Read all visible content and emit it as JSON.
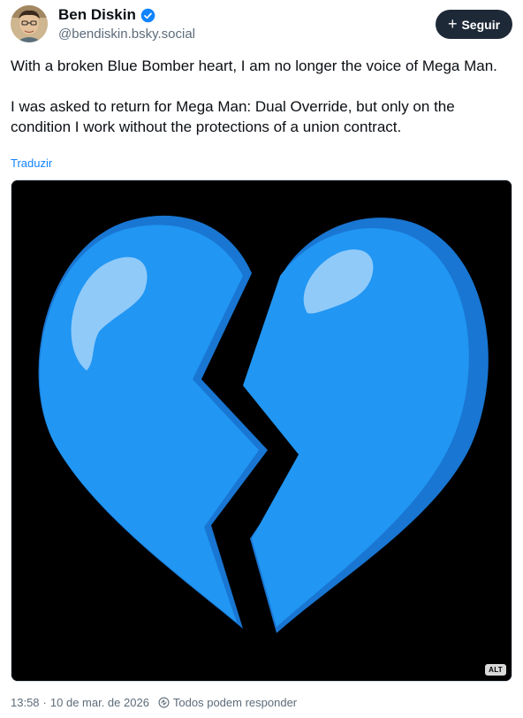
{
  "author": {
    "display_name": "Ben Diskin",
    "handle": "@bendiskin.bsky.social",
    "verified": true
  },
  "follow_button": {
    "icon": "plus-icon",
    "label": "Seguir"
  },
  "post": {
    "paragraphs": [
      "With a broken Blue Bomber heart, I am no longer the voice of Mega Man.",
      "I was asked to return for Mega Man: Dual Override, but only on the condition I work without the protections of a union contract."
    ],
    "translate_label": "Traduzir",
    "media": {
      "icon": "broken-heart-emoji",
      "alt_badge": "ALT"
    }
  },
  "meta": {
    "timestamp": "13:58",
    "separator": "·",
    "date": "10 de mar. de 2026",
    "reply_icon": "reply-settings-icon",
    "reply_settings": "Todos podem responder"
  },
  "colors": {
    "follow_button_bg": "#1e2937",
    "link": "#1083fe",
    "verified": "#1083fe",
    "heart_main": "#2196f3",
    "heart_shade": "#1976d2",
    "heart_highlight": "#90caf9",
    "secondary_text": "#5d6c7a"
  }
}
